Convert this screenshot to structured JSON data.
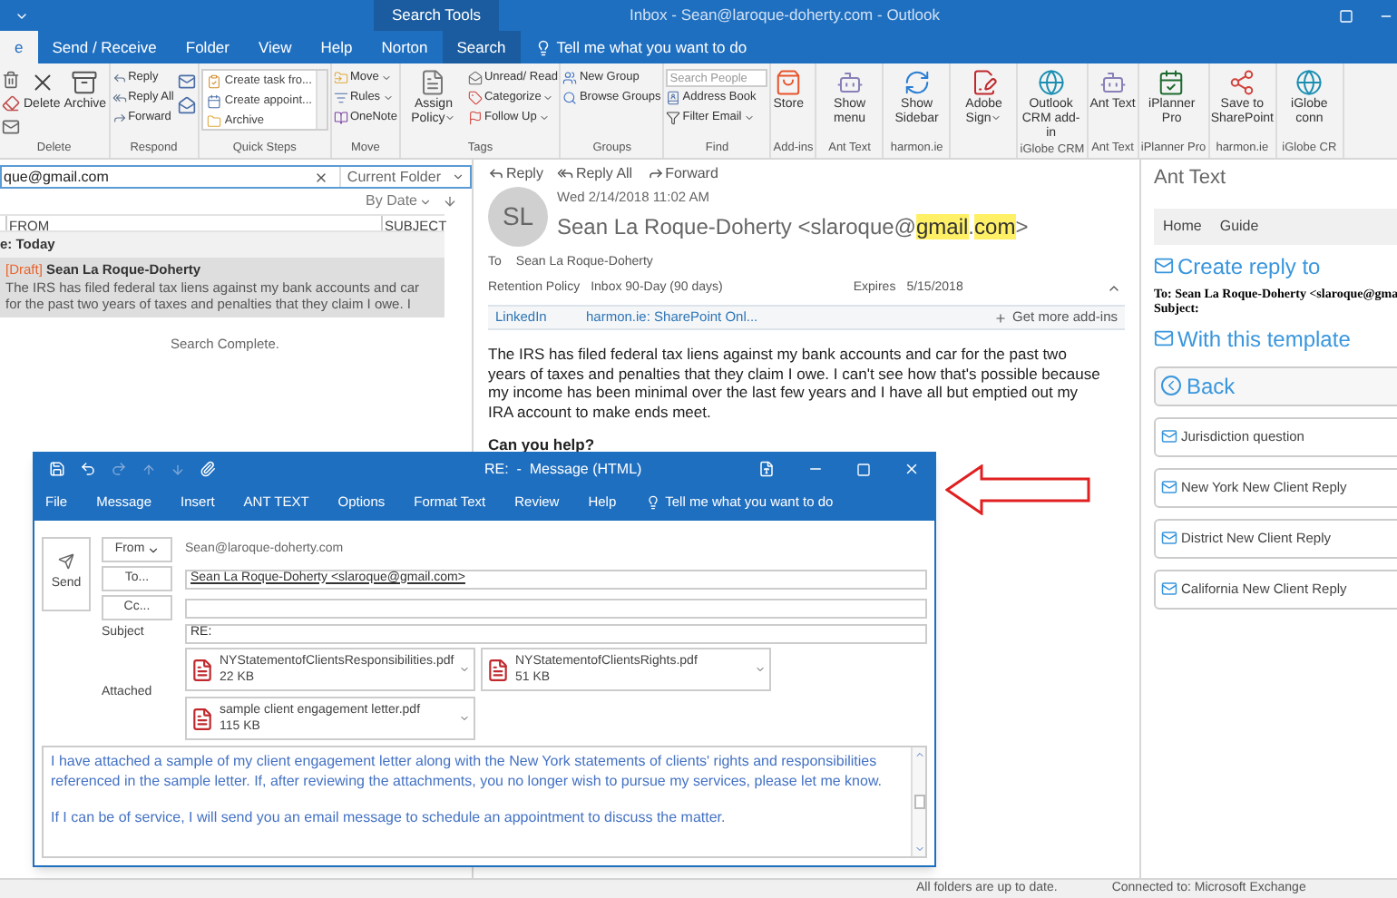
{
  "window": {
    "title": "Inbox - Sean@laroque-doherty.com - Outlook",
    "context_group": "Search Tools"
  },
  "tabs": [
    {
      "label": "e",
      "selected": true
    },
    {
      "label": "Send / Receive",
      "selected": false
    },
    {
      "label": "Folder",
      "selected": false
    },
    {
      "label": "View",
      "selected": false
    },
    {
      "label": "Help",
      "selected": false
    },
    {
      "label": "Norton",
      "selected": false
    },
    {
      "label": "Search",
      "selected": false,
      "contextual": true
    }
  ],
  "tell_me": "Tell me what you want to do",
  "ribbon": [
    {
      "label": "Delete",
      "items": [
        {
          "kind": "large",
          "label": "Delete",
          "dropdown": false
        },
        {
          "kind": "large",
          "label": "Archive",
          "dropdown": false
        }
      ]
    },
    {
      "label": "Respond",
      "items": [
        {
          "kind": "small",
          "label": "Reply",
          "dropdown": false
        },
        {
          "kind": "small",
          "label": "Reply All",
          "dropdown": false
        },
        {
          "kind": "small",
          "label": "Forward",
          "dropdown": false
        }
      ]
    },
    {
      "label": "Quick Steps",
      "items": [
        {
          "kind": "gallery",
          "label": "Create task fro..."
        },
        {
          "kind": "gallery",
          "label": "Create appoint..."
        },
        {
          "kind": "gallery",
          "label": "Archive"
        }
      ]
    },
    {
      "label": "Move",
      "items": [
        {
          "kind": "small",
          "label": "Move",
          "dropdown": true
        },
        {
          "kind": "small",
          "label": "Rules",
          "dropdown": true
        },
        {
          "kind": "small",
          "label": "OneNote",
          "dropdown": false
        }
      ]
    },
    {
      "label": "Tags",
      "items": [
        {
          "kind": "large",
          "label": "Assign Policy",
          "dropdown": true
        },
        {
          "kind": "small",
          "label": "Unread/ Read",
          "dropdown": false
        },
        {
          "kind": "small",
          "label": "Categorize",
          "dropdown": true
        },
        {
          "kind": "small",
          "label": "Follow Up",
          "dropdown": true
        }
      ]
    },
    {
      "label": "Groups",
      "items": [
        {
          "kind": "small",
          "label": "New Group",
          "dropdown": false
        },
        {
          "kind": "small",
          "label": "Browse Groups",
          "dropdown": false
        }
      ]
    },
    {
      "label": "Find",
      "items": [
        {
          "kind": "search",
          "placeholder": "Search People"
        },
        {
          "kind": "small",
          "label": "Address Book",
          "dropdown": false
        },
        {
          "kind": "small",
          "label": "Filter Email",
          "dropdown": true
        }
      ]
    },
    {
      "label": "Add-ins",
      "items": [
        {
          "kind": "large",
          "label": "Store",
          "dropdown": false
        }
      ]
    },
    {
      "label": "Ant Text",
      "items": [
        {
          "kind": "large",
          "label": "Show menu",
          "dropdown": false
        }
      ]
    },
    {
      "label": "harmon.ie",
      "items": [
        {
          "kind": "large",
          "label": "Show Sidebar",
          "dropdown": false
        }
      ]
    },
    {
      "items": [
        {
          "kind": "large",
          "label": "Adobe Sign",
          "dropdown": true
        }
      ]
    },
    {
      "label": "iGlobe CRM",
      "items": [
        {
          "kind": "large",
          "label": "Outlook CRM add-in",
          "dropdown": false
        }
      ]
    },
    {
      "label": "Ant Text",
      "items": [
        {
          "kind": "large",
          "label": "Ant Text",
          "dropdown": false
        }
      ]
    },
    {
      "label": "iPlanner Pro",
      "items": [
        {
          "kind": "large",
          "label": "iPlanner Pro",
          "dropdown": false
        }
      ]
    },
    {
      "label": "harmon.ie",
      "items": [
        {
          "kind": "large",
          "label": "Save to SharePoint",
          "dropdown": false
        }
      ]
    },
    {
      "label": "iGlobe CR",
      "items": [
        {
          "kind": "large",
          "label": "iGlobe conn",
          "dropdown": false
        }
      ]
    }
  ],
  "message_list": {
    "search": {
      "value": "que@gmail.com",
      "scope": "Current Folder"
    },
    "sort": "By Date",
    "columns": [
      "FROM",
      "SUBJECT"
    ],
    "group": "e: Today",
    "messages": [
      {
        "tag": "[Draft]",
        "sender": "Sean La Roque-Doherty",
        "preview_lines": [
          "The IRS has filed federal tax liens against my bank accounts and car",
          "for the past two years of taxes and penalties that they claim I owe. I"
        ],
        "selected": true
      }
    ],
    "status": "Search Complete."
  },
  "reading_pane": {
    "actions": [
      "Reply",
      "Reply All",
      "Forward"
    ],
    "avatar": "SL",
    "date": "Wed 2/14/2018 11:02 AM",
    "sender_parts": [
      {
        "text": "Sean La Roque-Doherty <slaroque@",
        "highlighted": false
      },
      {
        "text": "gmail",
        "highlighted": true
      },
      {
        "text": ".",
        "highlighted": false
      },
      {
        "text": "com",
        "highlighted": true
      },
      {
        "text": ">",
        "highlighted": false
      }
    ],
    "to_label": "To",
    "to": "Sean La Roque-Doherty",
    "retention_label": "Retention Policy",
    "retention": "Inbox 90-Day (90 days)",
    "expires_label": "Expires",
    "expires": "5/15/2018",
    "addins": [
      "LinkedIn",
      "harmon.ie: SharePoint Onl..."
    ],
    "more_addins": "Get more add-ins",
    "body": [
      "The IRS has filed federal tax liens against my bank accounts and car for the past two years of taxes and penalties that they claim I owe. I can't see how that's possible because my income has been minimal over the last few years and I have all but emptied out my IRA account to make ends meet.",
      "Can you help?"
    ]
  },
  "ant_text_pane": {
    "title": "Ant Text",
    "nav": [
      "Home",
      "Guide"
    ],
    "reply_heading": "Create reply to",
    "to_line": "To: Sean La Roque-Doherty <slaroque@gma",
    "subject_line": "Subject:",
    "template_heading": "With this template",
    "back": "Back",
    "templates": [
      "Jurisdiction question",
      "New York New Client Reply",
      "District New Client Reply",
      "California New Client Reply"
    ]
  },
  "compose": {
    "title": "RE:  -  Message (HTML)",
    "tabs": [
      "File",
      "Message",
      "Insert",
      "ANT TEXT",
      "Options",
      "Format Text",
      "Review",
      "Help"
    ],
    "tell_me": "Tell me what you want to do",
    "send": "Send",
    "from_button": "From",
    "from": "Sean@laroque-doherty.com",
    "to_button": "To...",
    "to": "Sean La Roque-Doherty <slaroque@gmail.com>",
    "cc_button": "Cc...",
    "subject_label": "Subject",
    "subject": "RE:",
    "attached_label": "Attached",
    "attachments": [
      {
        "name": "NYStatementofClientsResponsibilities.pdf",
        "size": "22 KB"
      },
      {
        "name": "NYStatementofClientsRights.pdf",
        "size": "51 KB"
      },
      {
        "name": "sample client engagement letter.pdf",
        "size": "115 KB"
      }
    ],
    "body": [
      "I have attached a sample of my client engagement letter along with the New York statements of clients' rights and responsibilities referenced in the sample letter. If, after reviewing the attachments, you no longer wish to pursue my services, please let me know.",
      "If I can be of service, I will send you an email message to schedule an appointment to discuss the matter."
    ]
  },
  "status_bar": {
    "sync": "All folders are up to date.",
    "connection": "Connected to: Microsoft Exchange"
  }
}
